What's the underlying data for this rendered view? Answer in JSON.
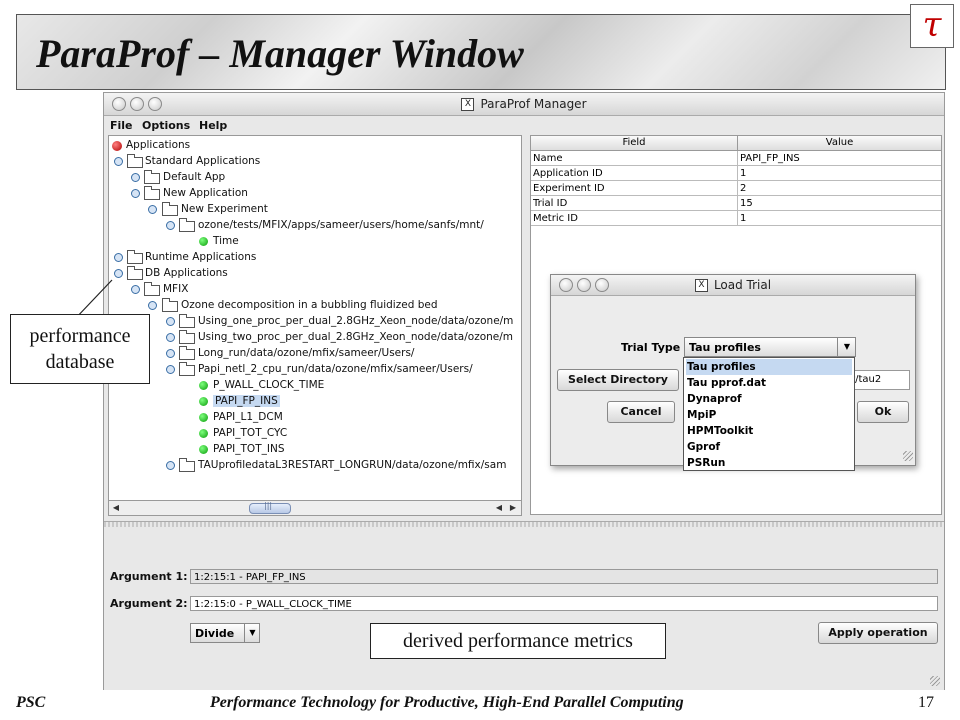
{
  "slide": {
    "title": "ParaProf  – Manager Window",
    "footer_left": "PSC",
    "footer_center": "Performance Technology for Productive, High-End Parallel Computing",
    "page_number": "17",
    "logo_glyph": "τ"
  },
  "window": {
    "title": "ParaProf Manager",
    "title_icon": "X",
    "menus": [
      "File",
      "Options",
      "Help"
    ]
  },
  "tree": {
    "rows": [
      {
        "label": "Applications",
        "icon": "red-dot"
      },
      {
        "label": "Standard Applications",
        "icon": "folder"
      },
      {
        "label": "Default App",
        "icon": "folder"
      },
      {
        "label": "New Application",
        "icon": "folder"
      },
      {
        "label": "New Experiment",
        "icon": "folder"
      },
      {
        "label": "ozone/tests/MFIX/apps/sameer/users/home/sanfs/mnt/",
        "icon": "folder"
      },
      {
        "label": "Time",
        "icon": "green-dot"
      },
      {
        "label": "Runtime Applications",
        "icon": "folder"
      },
      {
        "label": "DB Applications",
        "icon": "folder"
      },
      {
        "label": "MFIX",
        "icon": "folder"
      },
      {
        "label": "Ozone decomposition in a bubbling fluidized bed",
        "icon": "folder"
      },
      {
        "label": "Using_one_proc_per_dual_2.8GHz_Xeon_node/data/ozone/m",
        "icon": "folder"
      },
      {
        "label": "Using_two_proc_per_dual_2.8GHz_Xeon_node/data/ozone/m",
        "icon": "folder"
      },
      {
        "label": "Long_run/data/ozone/mfix/sameer/Users/",
        "icon": "folder"
      },
      {
        "label": "Papi_netl_2_cpu_run/data/ozone/mfix/sameer/Users/",
        "icon": "folder"
      },
      {
        "label": "P_WALL_CLOCK_TIME",
        "icon": "green-dot"
      },
      {
        "label": "PAPI_FP_INS",
        "icon": "green-dot"
      },
      {
        "label": "PAPI_L1_DCM",
        "icon": "green-dot"
      },
      {
        "label": "PAPI_TOT_CYC",
        "icon": "green-dot"
      },
      {
        "label": "PAPI_TOT_INS",
        "icon": "green-dot"
      },
      {
        "label": "TAUprofiledataL3RESTART_LONGRUN/data/ozone/mfix/sam",
        "icon": "folder"
      }
    ],
    "selected": "PAPI_FP_INS",
    "scroll_thumb_glyph": "|||"
  },
  "table": {
    "headers": [
      "Field",
      "Value"
    ],
    "rows": [
      [
        "Name",
        "PAPI_FP_INS"
      ],
      [
        "Application ID",
        "1"
      ],
      [
        "Experiment ID",
        "2"
      ],
      [
        "Trial ID",
        "15"
      ],
      [
        "Metric ID",
        "1"
      ]
    ]
  },
  "dialog": {
    "title": "Load Trial",
    "title_icon": "X",
    "trial_type_label": "Trial Type",
    "trial_type_value": "Tau profiles",
    "select_directory": "Select Directory",
    "cancel": "Cancel",
    "ok": "Ok",
    "path_value": "r/tau2",
    "options": [
      "Tau profiles",
      "Tau pprof.dat",
      "Dynaprof",
      "MpiP",
      "HPMToolkit",
      "Gprof",
      "PSRun"
    ]
  },
  "bottom": {
    "arg1_label": "Argument 1:",
    "arg1_value": "1:2:15:1 - PAPI_FP_INS",
    "arg2_label": "Argument 2:",
    "arg2_value": "1:2:15:0 - P_WALL_CLOCK_TIME",
    "operation": "Divide",
    "apply": "Apply operation"
  },
  "callouts": {
    "db_line1": "performance",
    "db_line2": "database",
    "derived": "derived performance metrics"
  }
}
